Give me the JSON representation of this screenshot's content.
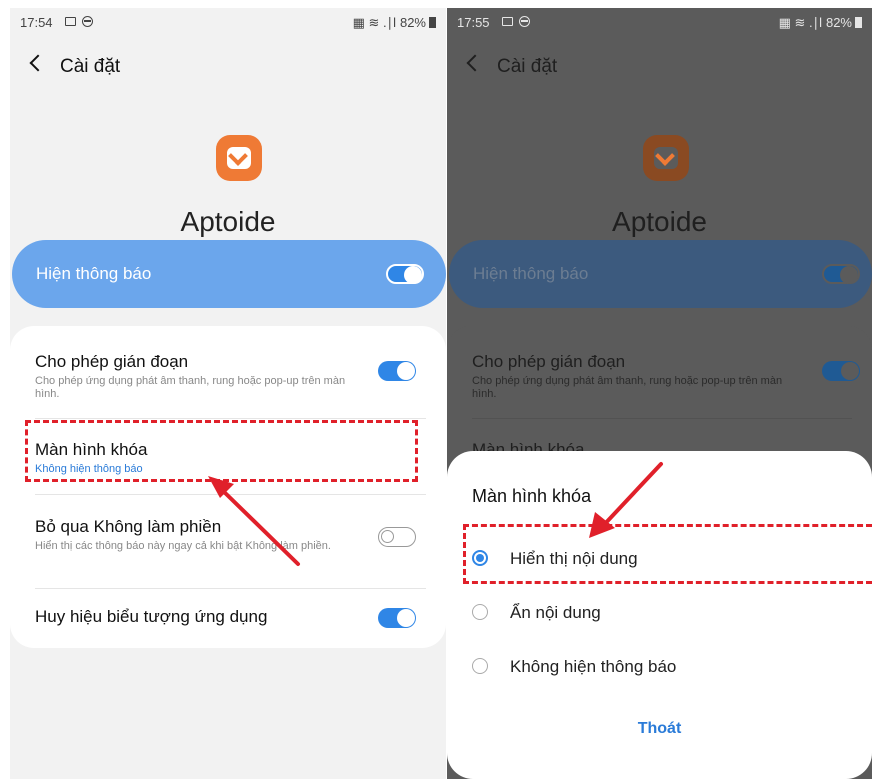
{
  "left": {
    "status": {
      "time": "17:54",
      "signal": "▦ ≋ .∣l",
      "battery": "82%"
    },
    "back_label": "Cài đặt",
    "app_name": "Aptoide",
    "master": {
      "label": "Hiện thông báo",
      "enabled": true
    },
    "settings": [
      {
        "title": "Cho phép gián đoạn",
        "subtitle": "Cho phép ứng dụng phát âm thanh, rung hoặc pop-up trên màn hình.",
        "enabled": true
      },
      {
        "title": "Màn hình khóa",
        "value": "Không hiện thông báo"
      },
      {
        "title": "Bỏ qua Không làm phiền",
        "subtitle": "Hiển thị các thông báo này ngay cả khi bật Không làm phiền.",
        "enabled": false
      },
      {
        "title": "Huy hiệu biểu tượng ứng dụng",
        "enabled": true
      }
    ]
  },
  "right": {
    "status": {
      "time": "17:55",
      "signal": "▦ ≋ .∣l",
      "battery": "82%"
    },
    "back_label": "Cài đặt",
    "app_name": "Aptoide",
    "master_label": "Hiện thông báo",
    "bg_row_title": "Cho phép gián đoạn",
    "bg_row_sub": "Cho phép ứng dụng phát âm thanh, rung hoặc pop-up trên màn hình.",
    "bg_row2_title": "Màn hình khóa",
    "dialog": {
      "title": "Màn hình khóa",
      "options": [
        "Hiển thị nội dung",
        "Ẩn nội dung",
        "Không hiện thông báo"
      ],
      "selected_index": 0,
      "exit_label": "Thoát"
    }
  },
  "colors": {
    "accent": "#2f86e6",
    "annotation": "#e0202a",
    "app_icon": "#ef7a35"
  }
}
